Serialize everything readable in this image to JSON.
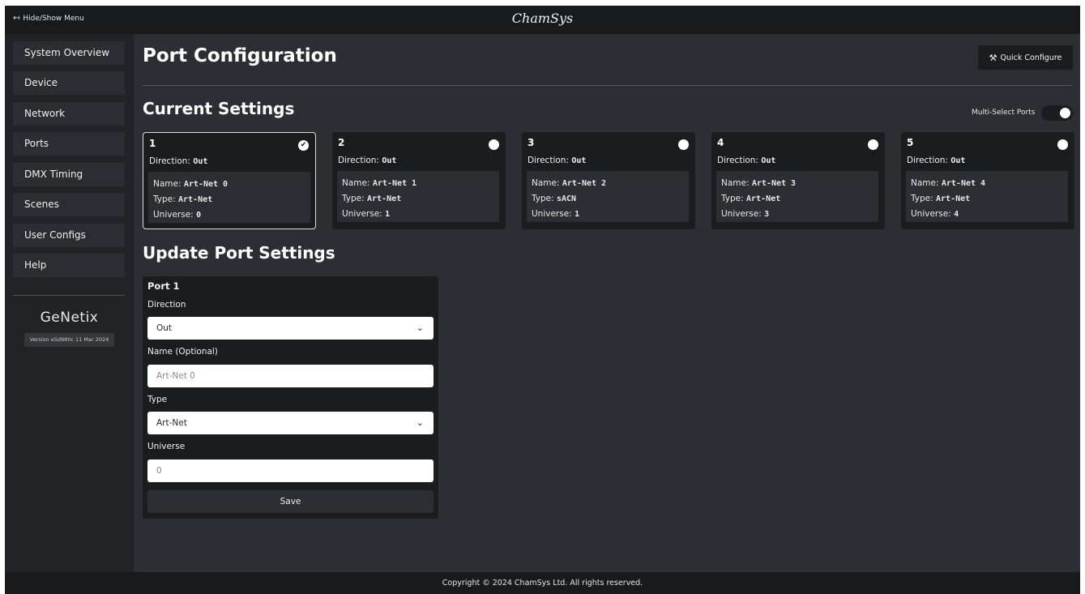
{
  "topbar": {
    "hide_menu_label": "Hide/Show Menu",
    "brand": "ChamSys"
  },
  "sidebar": {
    "items": [
      {
        "label": "System Overview"
      },
      {
        "label": "Device"
      },
      {
        "label": "Network"
      },
      {
        "label": "Ports"
      },
      {
        "label": "DMX Timing"
      },
      {
        "label": "Scenes"
      },
      {
        "label": "User Configs"
      },
      {
        "label": "Help"
      }
    ],
    "logo": "GeNetix",
    "version": "Version e5d980c 11 Mar 2024"
  },
  "main": {
    "title": "Port Configuration",
    "quick_configure_label": "Quick Configure",
    "current_settings_heading": "Current Settings",
    "multi_select_label": "Multi-Select Ports",
    "multi_select_on": true,
    "update_heading": "Update Port Settings"
  },
  "ports": [
    {
      "number": "1",
      "direction_label": "Direction:",
      "direction": "Out",
      "name_label": "Name:",
      "name": "Art-Net 0",
      "type_label": "Type:",
      "type": "Art-Net",
      "universe_label": "Universe:",
      "universe": "0",
      "selected": true
    },
    {
      "number": "2",
      "direction_label": "Direction:",
      "direction": "Out",
      "name_label": "Name:",
      "name": "Art-Net 1",
      "type_label": "Type:",
      "type": "Art-Net",
      "universe_label": "Universe:",
      "universe": "1",
      "selected": false
    },
    {
      "number": "3",
      "direction_label": "Direction:",
      "direction": "Out",
      "name_label": "Name:",
      "name": "Art-Net 2",
      "type_label": "Type:",
      "type": "sACN",
      "universe_label": "Universe:",
      "universe": "1",
      "selected": false
    },
    {
      "number": "4",
      "direction_label": "Direction:",
      "direction": "Out",
      "name_label": "Name:",
      "name": "Art-Net 3",
      "type_label": "Type:",
      "type": "Art-Net",
      "universe_label": "Universe:",
      "universe": "3",
      "selected": false
    },
    {
      "number": "5",
      "direction_label": "Direction:",
      "direction": "Out",
      "name_label": "Name:",
      "name": "Art-Net 4",
      "type_label": "Type:",
      "type": "Art-Net",
      "universe_label": "Universe:",
      "universe": "4",
      "selected": false
    }
  ],
  "form": {
    "port_label": "Port 1",
    "direction_label": "Direction",
    "direction_value": "Out",
    "name_label": "Name (Optional)",
    "name_placeholder": "Art-Net 0",
    "type_label": "Type",
    "type_value": "Art-Net",
    "universe_label": "Universe",
    "universe_placeholder": "0",
    "save_label": "Save"
  },
  "footer": {
    "copyright": "Copyright © 2024 ChamSys Ltd.  All rights reserved."
  },
  "icons": {
    "hide_menu": "sign-out-icon",
    "quick_configure": "magic-wand-icon",
    "select": "chevron-down-icon",
    "check": "check-icon"
  },
  "colors": {
    "background": "#2b2f33",
    "bar": "#191a1b",
    "sidebar": "#212427",
    "card": "#1a1c1e",
    "card_inner": "#2b2e32"
  }
}
